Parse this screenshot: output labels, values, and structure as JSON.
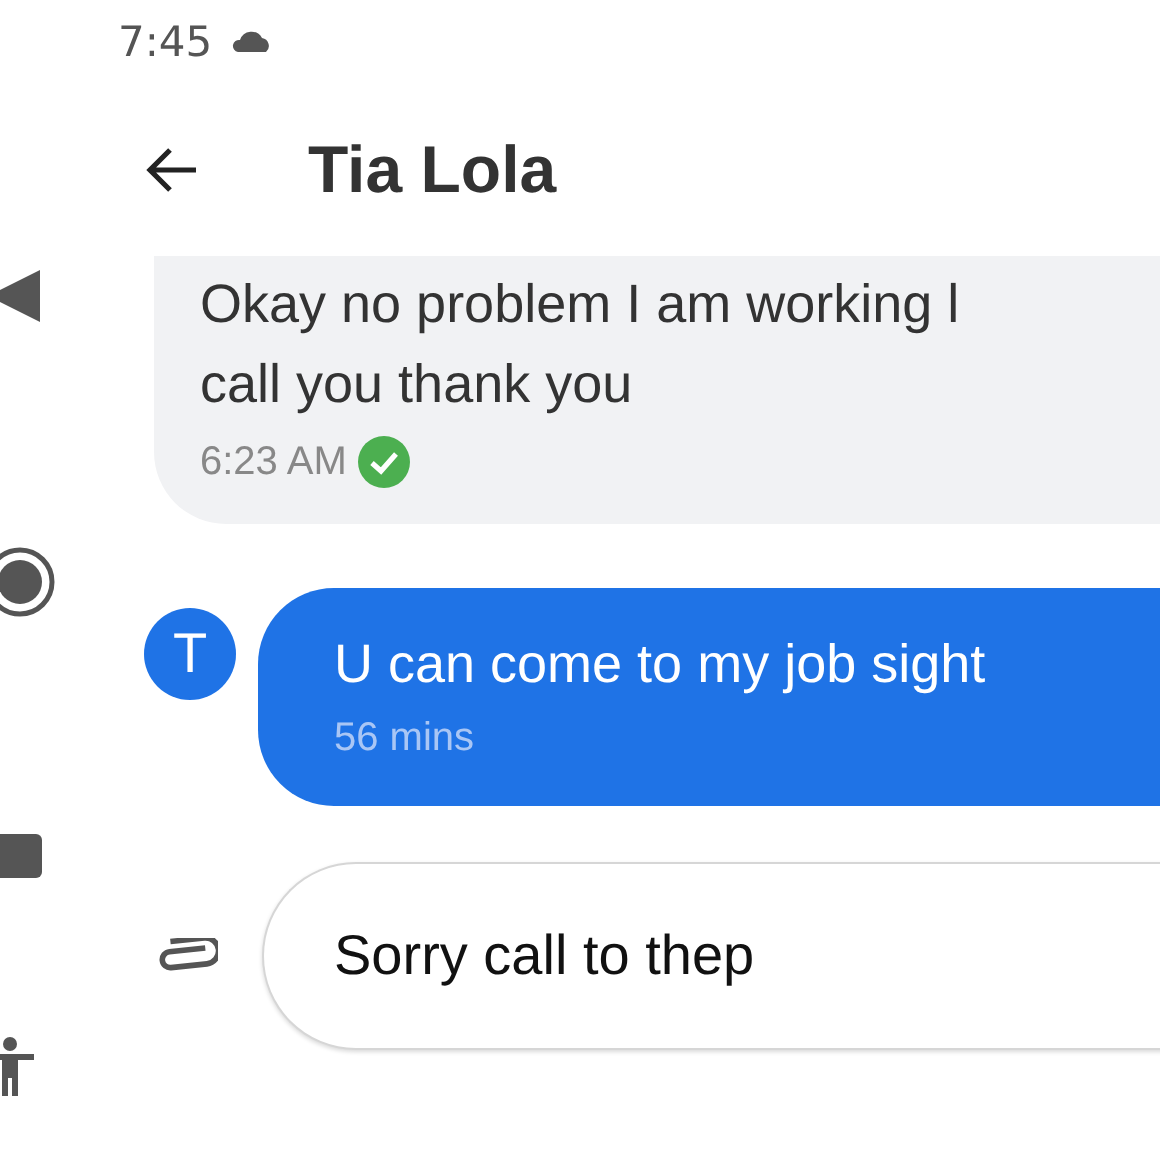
{
  "status_bar": {
    "time": "7:45"
  },
  "header": {
    "title": "Tia Lola"
  },
  "messages": [
    {
      "kind": "outgoing",
      "lines": [
        "Okay no problem I am working l",
        "call you thank you"
      ],
      "time": "6:23 AM",
      "delivered": true
    },
    {
      "kind": "incoming",
      "avatar": "T",
      "lines": [
        "U can come to my job sight"
      ],
      "time": "56 mins"
    }
  ],
  "composer": {
    "value": "Sorry call to thep"
  }
}
